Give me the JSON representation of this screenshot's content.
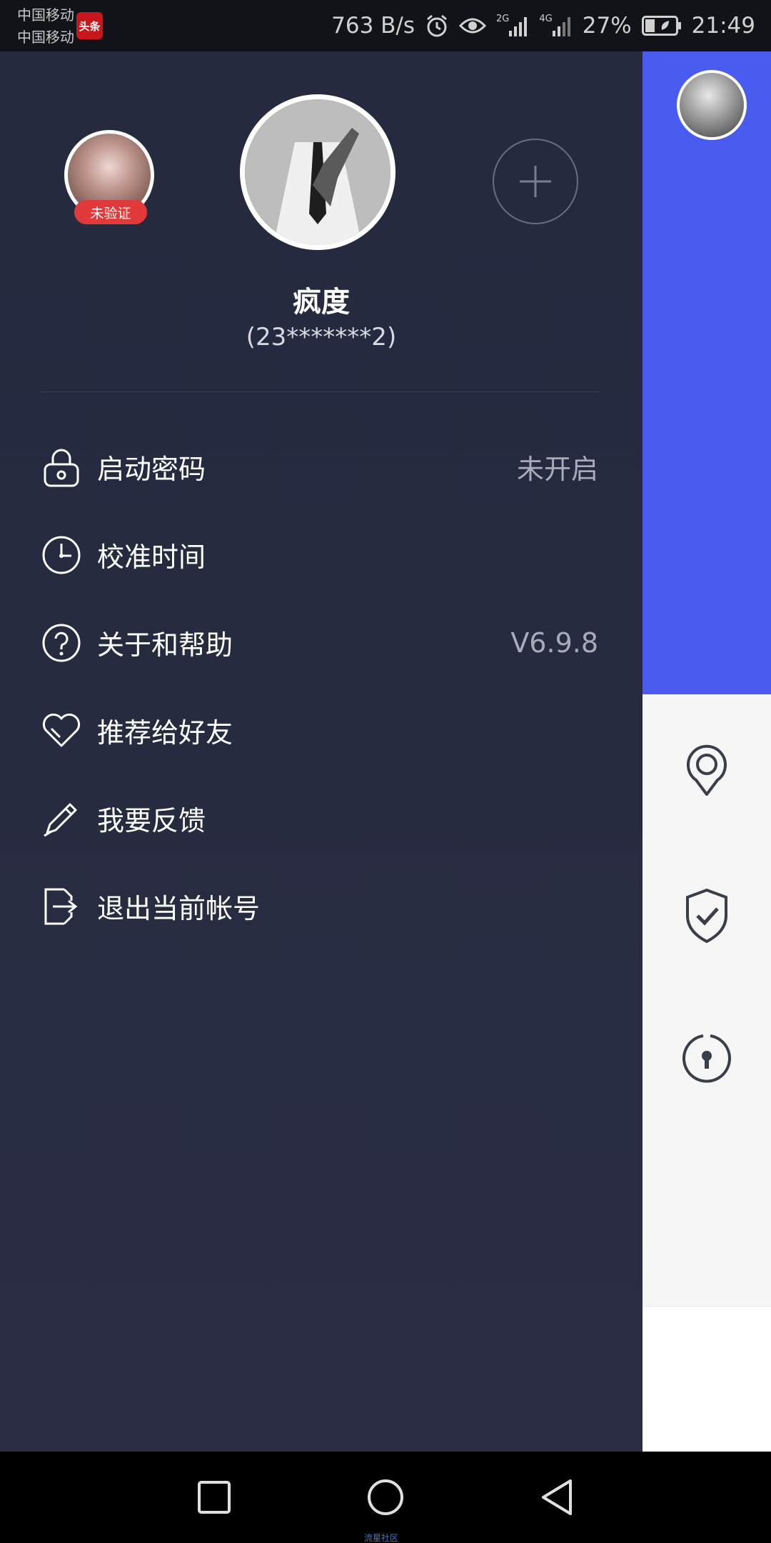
{
  "status_bar": {
    "carrier_1": "中国移动",
    "carrier_2": "中国移动",
    "app_badge": "头条",
    "net_speed": "763 B/s",
    "net_2g": "2G",
    "net_4g": "4G",
    "battery_percent": "27%",
    "time": "21:49"
  },
  "drawer": {
    "unverified_badge": "未验证",
    "username": "疯度",
    "account_id": "(23*******2)",
    "menu": [
      {
        "label": "启动密码",
        "value": "未开启",
        "icon": "lock-icon"
      },
      {
        "label": "校准时间",
        "value": "",
        "icon": "clock-icon"
      },
      {
        "label": "关于和帮助",
        "value": "V6.9.8",
        "icon": "help-icon"
      },
      {
        "label": "推荐给好友",
        "value": "",
        "icon": "heart-icon"
      },
      {
        "label": "我要反馈",
        "value": "",
        "icon": "pencil-icon"
      },
      {
        "label": "退出当前帐号",
        "value": "",
        "icon": "logout-icon"
      }
    ]
  },
  "nav_bar": {
    "tiny_label": "流星社区"
  },
  "colors": {
    "drawer_bg": "#272b40",
    "accent_blue": "#4a5cf0",
    "badge_red": "#e23a3a"
  }
}
